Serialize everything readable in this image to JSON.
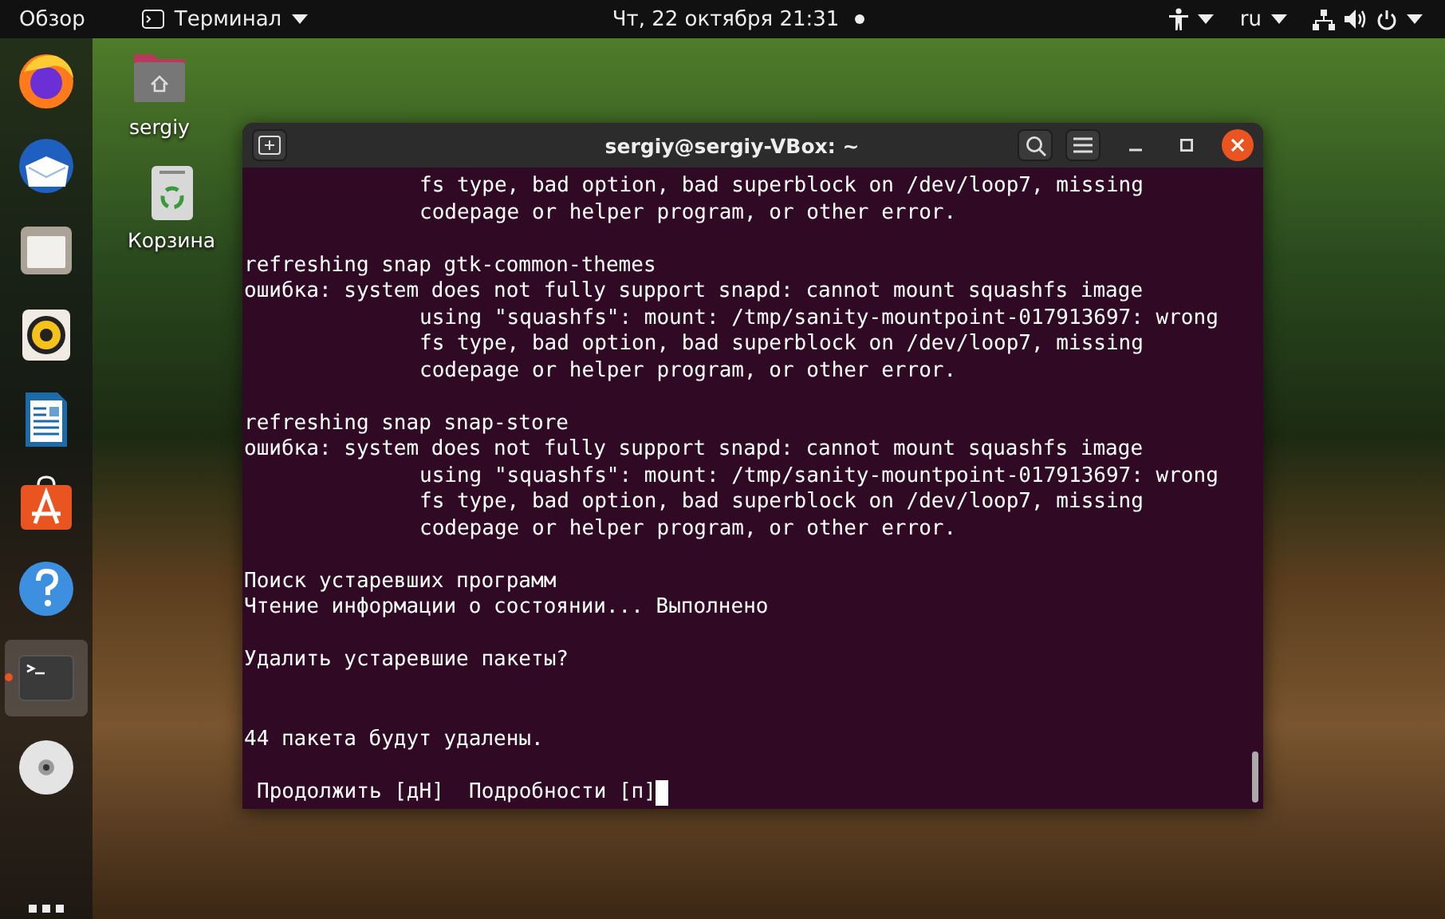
{
  "top_bar": {
    "activities": "Обзор",
    "app_menu": {
      "label": "Терминал"
    },
    "clock": "Чт, 22 октября  21:31",
    "notification_dot": true,
    "keyboard_layout": "ru"
  },
  "dock": {
    "items": [
      {
        "kind": "firefox",
        "running": false,
        "selected": false
      },
      {
        "kind": "thunderbird",
        "running": false,
        "selected": false
      },
      {
        "kind": "files",
        "running": false,
        "selected": false
      },
      {
        "kind": "rhythmbox",
        "running": false,
        "selected": false
      },
      {
        "kind": "writer",
        "running": false,
        "selected": false
      },
      {
        "kind": "software",
        "running": false,
        "selected": false
      },
      {
        "kind": "help",
        "running": false,
        "selected": false
      },
      {
        "kind": "terminal",
        "running": true,
        "selected": true
      },
      {
        "kind": "disc",
        "running": false,
        "selected": false
      }
    ]
  },
  "desktop_icons": [
    {
      "kind": "home",
      "label": "sergiy"
    },
    {
      "kind": "trash",
      "label": "Корзина"
    }
  ],
  "terminal": {
    "title": "sergiy@sergiy-VBox: ~",
    "lines": [
      {
        "kind": "indented",
        "text": "fs type, bad option, bad superblock on /dev/loop7, missing"
      },
      {
        "kind": "indented",
        "text": "codepage or helper program, or other error."
      },
      {
        "kind": "blank"
      },
      {
        "kind": "line",
        "text": "refreshing snap gtk-common-themes"
      },
      {
        "kind": "line",
        "text": "ошибка: system does not fully support snapd: cannot mount squashfs image"
      },
      {
        "kind": "indented",
        "text": "using \"squashfs\": mount: /tmp/sanity-mountpoint-017913697: wrong"
      },
      {
        "kind": "indented",
        "text": "fs type, bad option, bad superblock on /dev/loop7, missing"
      },
      {
        "kind": "indented",
        "text": "codepage or helper program, or other error."
      },
      {
        "kind": "blank"
      },
      {
        "kind": "line",
        "text": "refreshing snap snap-store"
      },
      {
        "kind": "line",
        "text": "ошибка: system does not fully support snapd: cannot mount squashfs image"
      },
      {
        "kind": "indented",
        "text": "using \"squashfs\": mount: /tmp/sanity-mountpoint-017913697: wrong"
      },
      {
        "kind": "indented",
        "text": "fs type, bad option, bad superblock on /dev/loop7, missing"
      },
      {
        "kind": "indented",
        "text": "codepage or helper program, or other error."
      },
      {
        "kind": "blank"
      },
      {
        "kind": "line",
        "text": "Поиск устаревших программ"
      },
      {
        "kind": "line",
        "text": "Чтение информации о состоянии... Выполнено"
      },
      {
        "kind": "blank"
      },
      {
        "kind": "line",
        "text": "Удалить устаревшие пакеты?"
      },
      {
        "kind": "blank"
      },
      {
        "kind": "blank"
      },
      {
        "kind": "line",
        "text": "44 пакета будут удалены."
      },
      {
        "kind": "blank"
      },
      {
        "kind": "prompt",
        "text": "Продолжить [дН]  Подробности [п]"
      }
    ]
  }
}
